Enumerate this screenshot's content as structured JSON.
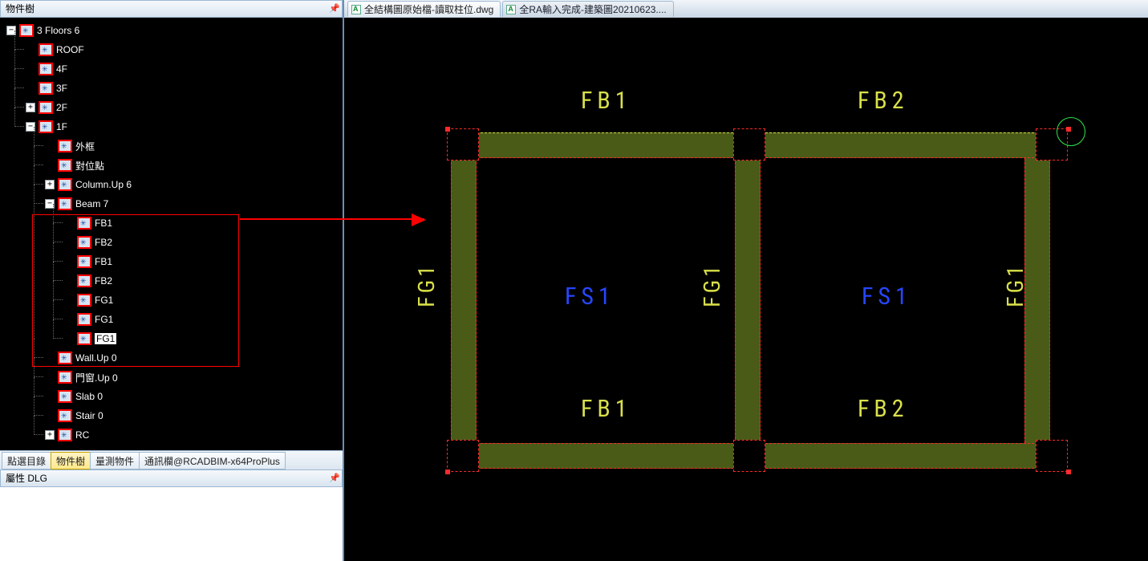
{
  "left": {
    "tree_title": "物件樹",
    "prop_title": "屬性 DLG",
    "root": "3 Floors 6",
    "floors": {
      "roof": "ROOF",
      "f4": "4F",
      "f3": "3F",
      "f2": "2F",
      "f1": "1F"
    },
    "f1_children": {
      "frame": "外框",
      "align": "對位點",
      "column": "Column.Up 6",
      "beam": "Beam 7",
      "wall": "Wall.Up 0",
      "door": "門窗.Up 0",
      "slab": "Slab 0",
      "stair": "Stair 0",
      "rc": "RC"
    },
    "beam_children": {
      "b0": "FB1",
      "b1": "FB2",
      "b2": "FB1",
      "b3": "FB2",
      "b4": "FG1",
      "b5": "FG1",
      "b6": "FG1"
    },
    "tabs": {
      "t1": "點選目錄",
      "t2": "物件樹",
      "t3": "量測物件",
      "t4": "通訊欄@RCADBIM-x64ProPlus"
    }
  },
  "docs": {
    "tab1": "全結構圖原始檔-讀取柱位.dwg",
    "tab2": "全RA輸入完成-建築圖20210623...."
  },
  "cad": {
    "fb1_top": "FB1",
    "fb2_top": "FB2",
    "fb1_bot": "FB1",
    "fb2_bot": "FB2",
    "fs1_l": "FS1",
    "fs1_r": "FS1",
    "fg1_l": "FG1",
    "fg1_m": "FG1",
    "fg1_r": "FG1"
  }
}
